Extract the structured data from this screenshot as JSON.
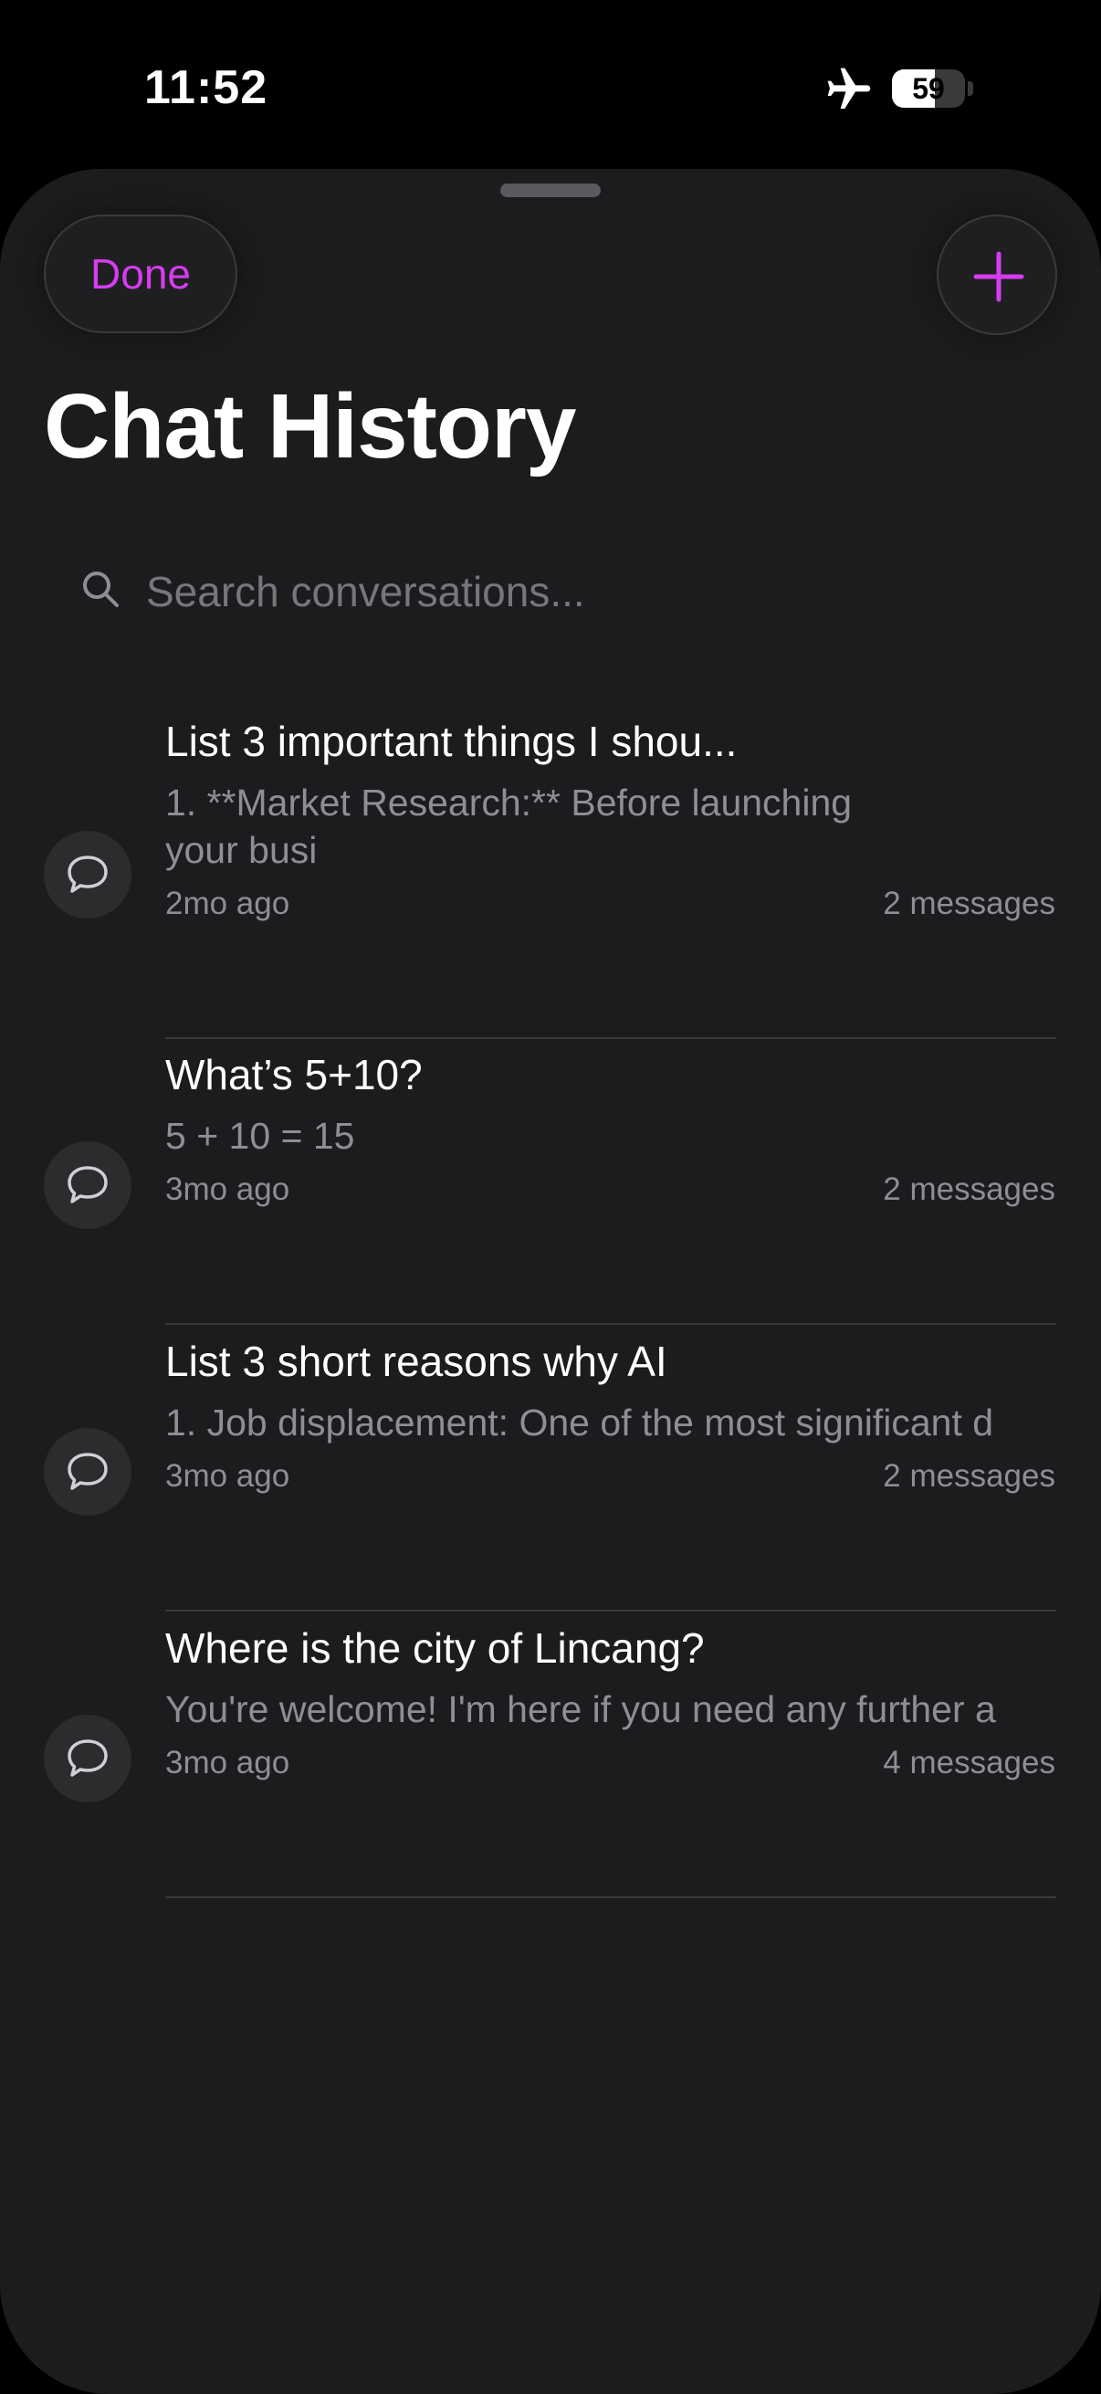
{
  "status_bar": {
    "time": "11:52",
    "battery": "59",
    "battery_level": 0.59,
    "icons": [
      "airplane-icon",
      "battery-icon"
    ]
  },
  "header": {
    "done_label": "Done",
    "add_icon": "plus-icon",
    "title": "Chat History"
  },
  "search": {
    "icon": "search-icon",
    "placeholder": "Search conversations..."
  },
  "colors": {
    "accent": "#d63cf0",
    "background": "#1c1c1e",
    "secondary_text": "#8e8e93",
    "divider": "#3a3a3c"
  },
  "conversations": [
    {
      "title": "List 3 important things I shou...",
      "preview": "1. **Market Research:** Before launching your busi",
      "date": "2mo ago",
      "count": "2 messages",
      "icon": "chat-bubble-icon"
    },
    {
      "title": "What’s 5+10?",
      "preview": "5 + 10 = 15",
      "date": "3mo ago",
      "count": "2 messages",
      "icon": "chat-bubble-icon"
    },
    {
      "title": "List 3 short reasons why AI",
      "preview": "1. Job displacement: One of the most significant d",
      "date": "3mo ago",
      "count": "2 messages",
      "icon": "chat-bubble-icon"
    },
    {
      "title": "Where is the city of Lincang?",
      "preview": "You're welcome! I'm here if you need any further a",
      "date": "3mo ago",
      "count": "4 messages",
      "icon": "chat-bubble-icon"
    }
  ]
}
